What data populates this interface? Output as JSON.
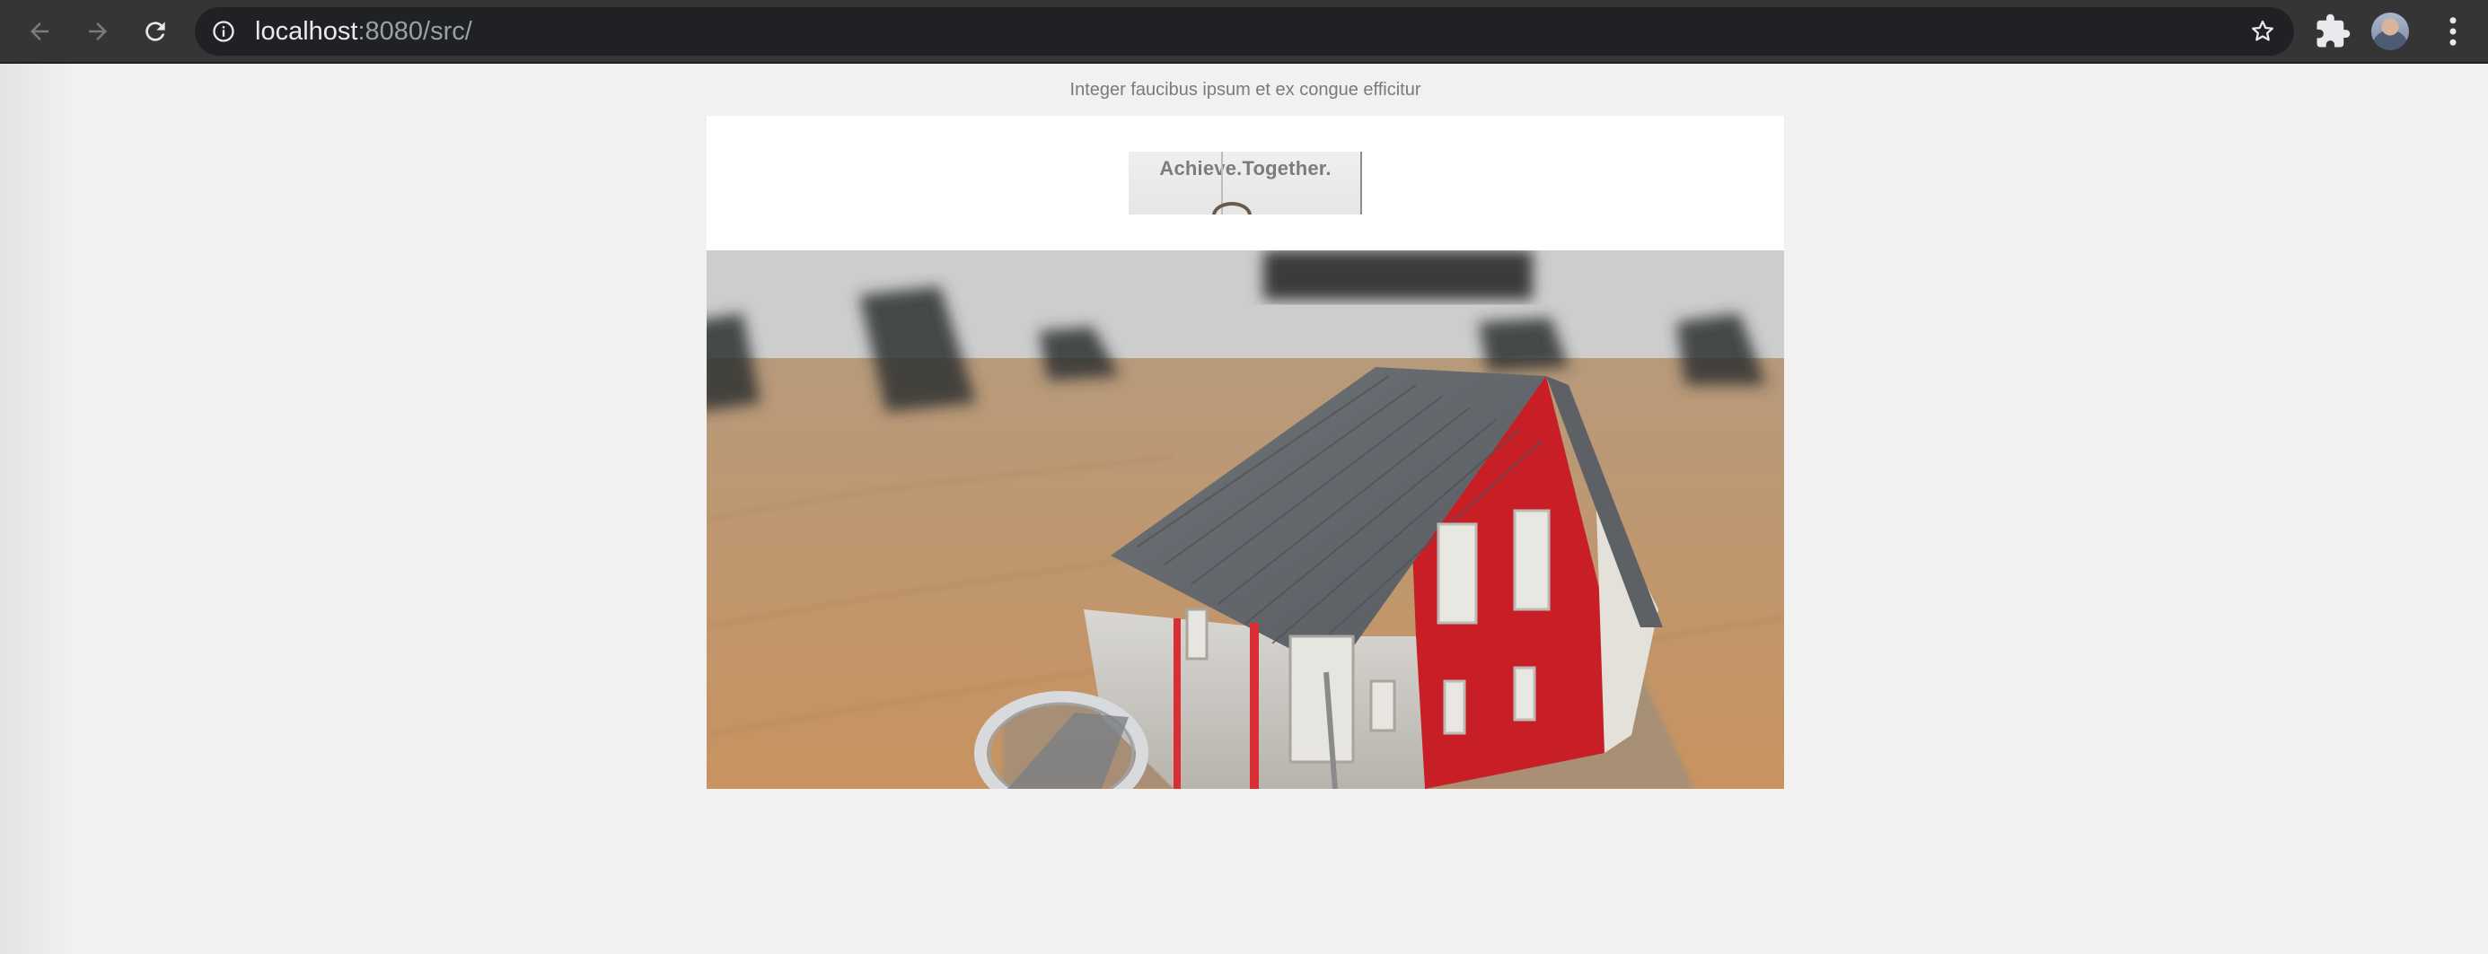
{
  "browser": {
    "url_host": "localhost",
    "url_path": ":8080/src/",
    "icons": [
      "back-arrow-icon",
      "forward-arrow-icon",
      "reload-icon",
      "info-icon",
      "star-icon",
      "puzzle-icon",
      "kebab-menu-icon"
    ]
  },
  "email": {
    "preheader": "Integer faucibus ipsum et ex congue efficitur",
    "logo_text": "Achieve.Together.",
    "hero_image": "house-model-photo"
  },
  "colors": {
    "chrome": "#353535",
    "omnibox": "#202124",
    "page_bg": "#f1f1f1",
    "header_bg": "#ffffff"
  }
}
